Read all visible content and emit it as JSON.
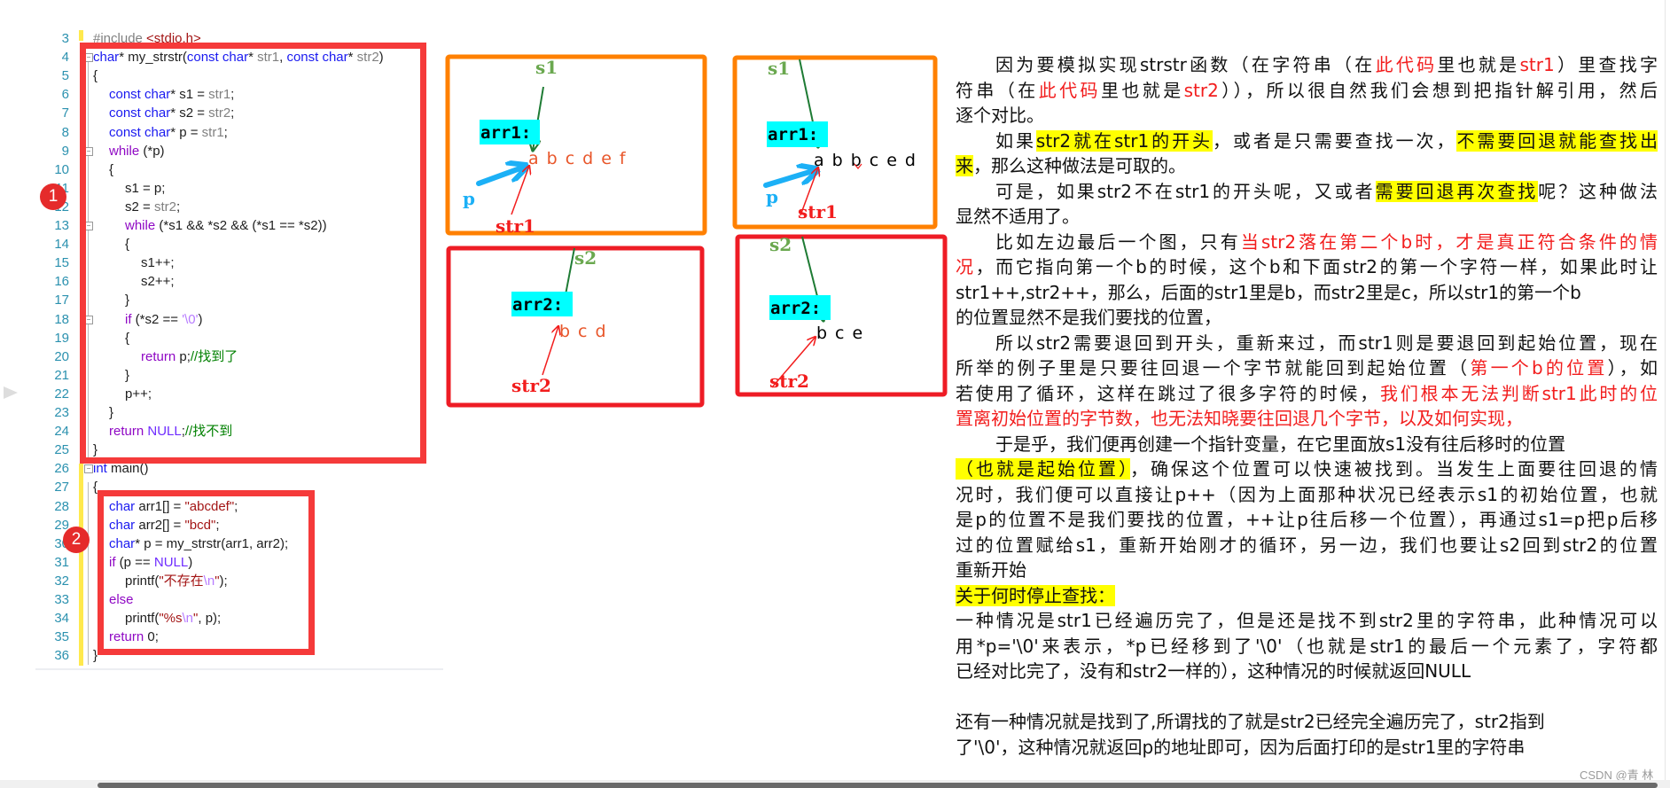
{
  "editor": {
    "lines": [
      {
        "n": "3",
        "indent": 0,
        "tokens": [
          [
            "pp",
            "#include "
          ],
          [
            "str",
            "<stdio.h>"
          ]
        ]
      },
      {
        "n": "4",
        "indent": 0,
        "tokens": [
          [
            "kw",
            "char"
          ],
          [
            "",
            "* my_strstr("
          ],
          [
            "kw",
            "const char"
          ],
          [
            "",
            "* "
          ],
          [
            "prm",
            "str1"
          ],
          [
            "",
            ", "
          ],
          [
            "kw",
            "const char"
          ],
          [
            "",
            "* "
          ],
          [
            "prm",
            "str2"
          ],
          [
            "",
            ")"
          ]
        ]
      },
      {
        "n": "5",
        "indent": 0,
        "tokens": [
          [
            "",
            "{"
          ]
        ]
      },
      {
        "n": "6",
        "indent": 1,
        "tokens": [
          [
            "kw",
            "const char"
          ],
          [
            "",
            "* s1 = "
          ],
          [
            "prm",
            "str1"
          ],
          [
            "",
            ";"
          ]
        ]
      },
      {
        "n": "7",
        "indent": 1,
        "tokens": [
          [
            "kw",
            "const char"
          ],
          [
            "",
            "* s2 = "
          ],
          [
            "prm",
            "str2"
          ],
          [
            "",
            ";"
          ]
        ]
      },
      {
        "n": "8",
        "indent": 1,
        "tokens": [
          [
            "kw",
            "const char"
          ],
          [
            "",
            "* p = "
          ],
          [
            "prm",
            "str1"
          ],
          [
            "",
            ";"
          ]
        ]
      },
      {
        "n": "9",
        "indent": 1,
        "tokens": [
          [
            "ctl",
            "while"
          ],
          [
            "",
            " (*p)"
          ]
        ]
      },
      {
        "n": "10",
        "indent": 1,
        "tokens": [
          [
            "",
            "{"
          ]
        ]
      },
      {
        "n": "11",
        "indent": 2,
        "tokens": [
          [
            "",
            "s1 = p;"
          ]
        ]
      },
      {
        "n": "12",
        "indent": 2,
        "tokens": [
          [
            "",
            "s2 = "
          ],
          [
            "prm",
            "str2"
          ],
          [
            "",
            ";"
          ]
        ]
      },
      {
        "n": "13",
        "indent": 2,
        "tokens": [
          [
            "ctl",
            "while"
          ],
          [
            "",
            " (*s1 && *s2 && (*s1 == *s2))"
          ]
        ]
      },
      {
        "n": "14",
        "indent": 2,
        "tokens": [
          [
            "",
            "{"
          ]
        ]
      },
      {
        "n": "15",
        "indent": 3,
        "tokens": [
          [
            "",
            "s1++;"
          ]
        ]
      },
      {
        "n": "16",
        "indent": 3,
        "tokens": [
          [
            "",
            "s2++;"
          ]
        ]
      },
      {
        "n": "17",
        "indent": 2,
        "tokens": [
          [
            "",
            "}"
          ]
        ]
      },
      {
        "n": "18",
        "indent": 2,
        "tokens": [
          [
            "ctl",
            "if"
          ],
          [
            "",
            " (*s2 == "
          ],
          [
            "chr",
            "'\\0'"
          ],
          [
            "",
            ")"
          ]
        ]
      },
      {
        "n": "19",
        "indent": 2,
        "tokens": [
          [
            "",
            "{"
          ]
        ]
      },
      {
        "n": "20",
        "indent": 3,
        "tokens": [
          [
            "ctl",
            "return"
          ],
          [
            "",
            " p;"
          ],
          [
            "cmt",
            "//找到了"
          ]
        ]
      },
      {
        "n": "21",
        "indent": 2,
        "tokens": [
          [
            "",
            "}"
          ]
        ]
      },
      {
        "n": "22",
        "indent": 2,
        "tokens": [
          [
            "",
            "p++;"
          ]
        ]
      },
      {
        "n": "23",
        "indent": 1,
        "tokens": [
          [
            "",
            "}"
          ]
        ]
      },
      {
        "n": "24",
        "indent": 1,
        "tokens": [
          [
            "ctl",
            "return"
          ],
          [
            "",
            " "
          ],
          [
            "mac",
            "NULL"
          ],
          [
            "",
            ";"
          ],
          [
            "cmt",
            "//找不到"
          ]
        ]
      },
      {
        "n": "25",
        "indent": 0,
        "tokens": [
          [
            "",
            "}"
          ]
        ]
      },
      {
        "n": "26",
        "indent": 0,
        "tokens": [
          [
            "kw",
            "int"
          ],
          [
            "",
            " main()"
          ]
        ]
      },
      {
        "n": "27",
        "indent": 0,
        "tokens": [
          [
            "",
            "{"
          ]
        ]
      },
      {
        "n": "28",
        "indent": 1,
        "tokens": [
          [
            "kw",
            "char"
          ],
          [
            "",
            " arr1[] = "
          ],
          [
            "str",
            "\"abcdef\""
          ],
          [
            "",
            ";"
          ]
        ]
      },
      {
        "n": "29",
        "indent": 1,
        "tokens": [
          [
            "kw",
            "char"
          ],
          [
            "",
            " arr2[] = "
          ],
          [
            "str",
            "\"bcd\""
          ],
          [
            "",
            ";"
          ]
        ]
      },
      {
        "n": "30",
        "indent": 1,
        "tokens": [
          [
            "kw",
            "char"
          ],
          [
            "",
            "* p = my_strstr(arr1, arr2);"
          ]
        ]
      },
      {
        "n": "31",
        "indent": 1,
        "tokens": [
          [
            "ctl",
            "if"
          ],
          [
            "",
            " (p == "
          ],
          [
            "mac",
            "NULL"
          ],
          [
            "",
            ")"
          ]
        ]
      },
      {
        "n": "32",
        "indent": 2,
        "tokens": [
          [
            "",
            "printf("
          ],
          [
            "str",
            "\"不存在"
          ],
          [
            "esc",
            "\\n"
          ],
          [
            "str",
            "\""
          ],
          [
            "",
            ");"
          ]
        ]
      },
      {
        "n": "33",
        "indent": 1,
        "tokens": [
          [
            "ctl",
            "else"
          ]
        ]
      },
      {
        "n": "34",
        "indent": 2,
        "tokens": [
          [
            "",
            "printf("
          ],
          [
            "str",
            "\"%s"
          ],
          [
            "esc",
            "\\n"
          ],
          [
            "str",
            "\""
          ],
          [
            "",
            ", p);"
          ]
        ]
      },
      {
        "n": "35",
        "indent": 1,
        "tokens": [
          [
            "ctl",
            "return"
          ],
          [
            "",
            " 0;"
          ]
        ]
      },
      {
        "n": "36",
        "indent": 0,
        "tokens": [
          [
            "",
            "}"
          ]
        ]
      }
    ],
    "badges": [
      "1",
      "2"
    ]
  },
  "diagrams": {
    "box1": {
      "s": "s1",
      "arr": "arr1:",
      "chars": "abcdef",
      "p": "p",
      "str": "str1"
    },
    "box2": {
      "s": "s1",
      "arr": "arr1:",
      "chars": "abbced",
      "p": "p",
      "str": "str1"
    },
    "box3": {
      "s": "s2",
      "arr": "arr2:",
      "chars": "bcd",
      "str": "str2"
    },
    "box4": {
      "s": "s2",
      "arr": "arr2:",
      "chars": "bce",
      "str": "str2"
    }
  },
  "colors": {
    "highlight": "#ffff00",
    "emphasis": "#f21d1d",
    "box_red": "#f53a3a",
    "box_orange": "#ff8000",
    "cyan": "#00ffff"
  },
  "article": {
    "lines": [
      {
        "indent": true,
        "full": true,
        "segs": [
          [
            "",
            "因为要模拟实现strstr函数（在字符串（在"
          ],
          [
            "r",
            "此代码"
          ],
          [
            "",
            "里也就是"
          ],
          [
            "r",
            "str1"
          ],
          [
            "",
            "）里查找字"
          ]
        ]
      },
      {
        "full": true,
        "segs": [
          [
            "",
            "符串（在"
          ],
          [
            "r",
            "此代码"
          ],
          [
            "",
            "里也就是"
          ],
          [
            "r",
            "str2"
          ],
          [
            "",
            "）），所以很自然我们会想到把指针解引用，然后"
          ]
        ]
      },
      {
        "segs": [
          [
            "",
            "逐个对比。"
          ]
        ]
      },
      {
        "indent": true,
        "full": true,
        "segs": [
          [
            "",
            "如果"
          ],
          [
            "y",
            "str2就在str1的开头"
          ],
          [
            "",
            "，或者是只需要查找一次，"
          ],
          [
            "y",
            "不需要回退就能查找出"
          ]
        ]
      },
      {
        "segs": [
          [
            "y",
            "来"
          ],
          [
            "",
            "，那么这种做法是可取的。"
          ]
        ]
      },
      {
        "indent": true,
        "full": true,
        "segs": [
          [
            "",
            "可是，如果str2不在str1的开头呢，又或者"
          ],
          [
            "y",
            "需要回退再次查找"
          ],
          [
            "",
            "呢？这种做法"
          ]
        ]
      },
      {
        "segs": [
          [
            "",
            "显然不适用了。"
          ]
        ]
      },
      {
        "indent": true,
        "full": true,
        "segs": [
          [
            "",
            "比如左边最后一个图，只有"
          ],
          [
            "r",
            "当str2落在第二个b时，才是真正符合条件的情"
          ]
        ]
      },
      {
        "full": true,
        "segs": [
          [
            "r",
            "况"
          ],
          [
            "",
            "，而它指向第一个b的时候，这个b和下面str2的第一个字符一样，如果此时让"
          ]
        ]
      },
      {
        "segs": [
          [
            "",
            "str1++,str2++，那么，后面的str1里是b，而str2里是c，所以str1的第一个b"
          ]
        ]
      },
      {
        "segs": [
          [
            "",
            "的位置显然不是我们要找的位置，"
          ]
        ]
      },
      {
        "indent": true,
        "full": true,
        "segs": [
          [
            "",
            "所以str2需要退回到开头，重新来过，而str1则是要退回到起始位置，现在"
          ]
        ]
      },
      {
        "full": true,
        "segs": [
          [
            "",
            "所举的例子里是只要往回退一个字节就能回到起始位置（"
          ],
          [
            "r",
            "第一个b的位置"
          ],
          [
            "",
            "），如"
          ]
        ]
      },
      {
        "full": true,
        "segs": [
          [
            "",
            "若使用了循环，这样在跳过了很多字符的时候，"
          ],
          [
            "r",
            "我们根本无法判断str1此时的位"
          ]
        ]
      },
      {
        "segs": [
          [
            "r",
            "置离初始位置的字节数，也无法知晓要往回退几个字节，以及如何实现，"
          ]
        ]
      },
      {
        "indent": true,
        "segs": [
          [
            "",
            "于是乎，我们便再创建一个指针变量，在它里面放s1没有往后移时的位置"
          ]
        ]
      },
      {
        "full": true,
        "segs": [
          [
            "y",
            "（也就是起始位置）"
          ],
          [
            "",
            "，确保这个位置可以快速被找到。当发生上面要往回退的情"
          ]
        ]
      },
      {
        "full": true,
        "segs": [
          [
            "",
            "况时，我们便可以直接让p++（因为上面那种状况已经表示s1的初始位置，也就"
          ]
        ]
      },
      {
        "full": true,
        "segs": [
          [
            "",
            "是p的位置不是我们要找的位置，++让p往后移一个位置），再通过s1=p把p后移"
          ]
        ]
      },
      {
        "full": true,
        "segs": [
          [
            "",
            "过的位置赋给s1，重新开始刚才的循环，另一边，我们也要让s2回到str2的位置"
          ]
        ]
      },
      {
        "segs": [
          [
            "",
            "重新开始"
          ]
        ]
      },
      {
        "segs": [
          [
            "y",
            "关于何时停止查找："
          ]
        ]
      },
      {
        "full": true,
        "segs": [
          [
            "",
            "一种情况是str1已经遍历完了，但是还是找不到str2里的字符串，此种情况可以"
          ]
        ]
      },
      {
        "full": true,
        "segs": [
          [
            "",
            "用*p='\\0'来表示，*p已经移到了'\\0'（也就是str1的最后一个元素了，字符都"
          ]
        ]
      },
      {
        "segs": [
          [
            "",
            "已经对比完了，没有和str2一样的），这种情况的时候就返回NULL"
          ]
        ]
      },
      {
        "segs": []
      },
      {
        "segs": [
          [
            "",
            "还有一种情况就是找到了,所谓找的了就是str2已经完全遍历完了，str2指到"
          ]
        ]
      },
      {
        "segs": [
          [
            "",
            "了'\\0'，这种情况就返回p的地址即可，因为后面打印的是str1里的字符串"
          ]
        ]
      }
    ]
  },
  "watermark": "CSDN @青 林"
}
